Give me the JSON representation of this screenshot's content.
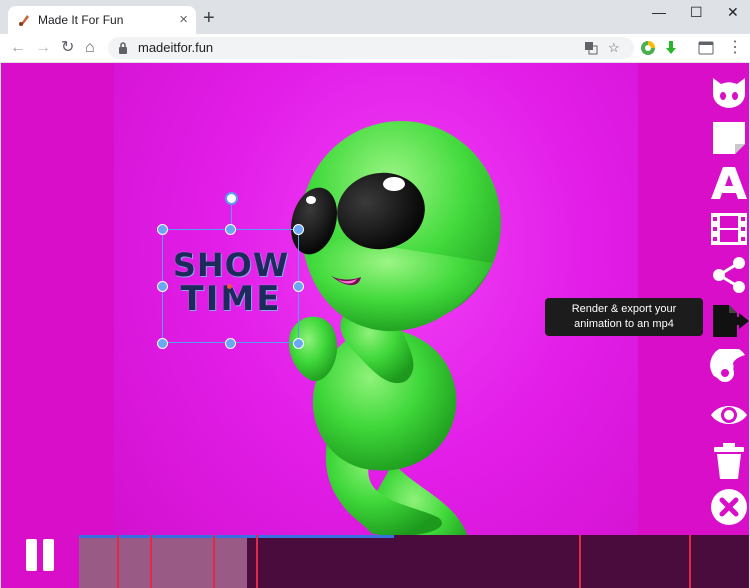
{
  "browser": {
    "tab_title": "Made It For Fun",
    "tab_close": "×",
    "new_tab": "+",
    "url": "madeitfor.fun",
    "window_controls": {
      "minimize": "—",
      "maximize": "☐",
      "close": "✕"
    },
    "nav": {
      "back": "←",
      "forward": "→",
      "reload": "↻",
      "home": "⌂",
      "menu": "⋮"
    }
  },
  "canvas": {
    "text_layer": {
      "line1": "SHOW",
      "line2": "TIME"
    }
  },
  "sidebar": {
    "tools": [
      {
        "icon": "github-icon"
      },
      {
        "icon": "sticky-note-icon"
      },
      {
        "icon": "text-icon",
        "glyph": "A"
      },
      {
        "icon": "film-icon"
      },
      {
        "icon": "share-icon"
      },
      {
        "icon": "export-file-icon"
      },
      {
        "icon": "effect-icon"
      },
      {
        "icon": "preview-eye-icon"
      },
      {
        "icon": "trash-icon"
      },
      {
        "icon": "close-circle-icon"
      }
    ],
    "tooltip": {
      "line1": "Render & export your",
      "line2": "animation to an mp4"
    }
  },
  "timeline": {
    "played_fraction": 0.25,
    "progress_fraction": 0.47,
    "colors": {
      "bar": "#4a0b3d",
      "played": "#9a5a86",
      "progress": "#3a6fe0",
      "marker": "#e02a4a"
    }
  },
  "colors": {
    "background": "#d80ec8",
    "alien": "#3ee23e"
  }
}
